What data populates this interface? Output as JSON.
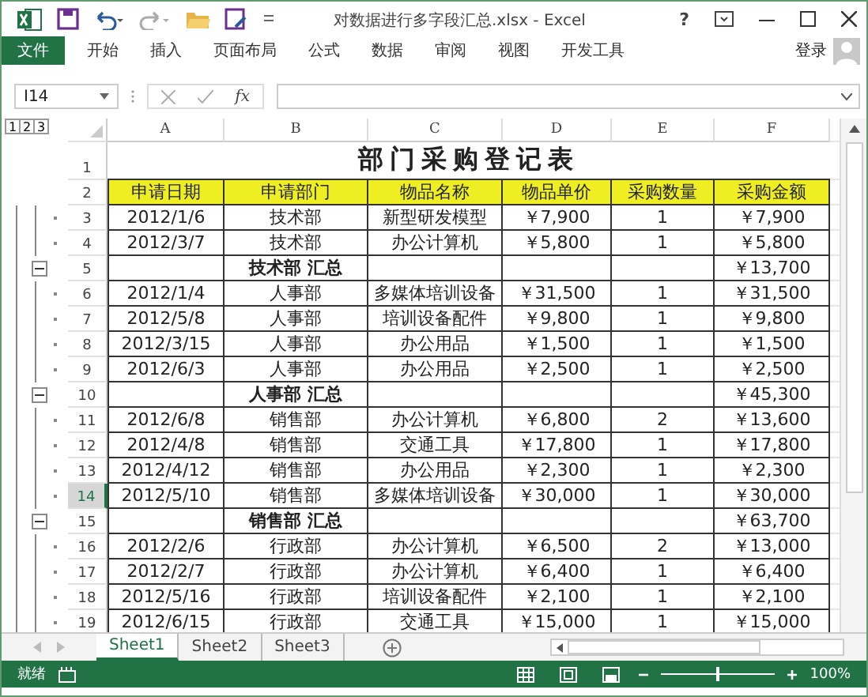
{
  "window": {
    "title": "对数据进行多字段汇总.xlsx - Excel",
    "help": "?"
  },
  "ribbon_tabs": [
    {
      "label": "文件",
      "kind": "file"
    },
    {
      "label": "开始",
      "kind": "tab"
    },
    {
      "label": "插入",
      "kind": "tab"
    },
    {
      "label": "页面布局",
      "kind": "tab"
    },
    {
      "label": "公式",
      "kind": "tab"
    },
    {
      "label": "数据",
      "kind": "tab"
    },
    {
      "label": "审阅",
      "kind": "tab"
    },
    {
      "label": "视图",
      "kind": "tab"
    },
    {
      "label": "开发工具",
      "kind": "tab"
    }
  ],
  "account": {
    "sign_in": "登录"
  },
  "formula_bar": {
    "name_box": "I14",
    "function_label": "fx"
  },
  "outline_levels": [
    "1",
    "2",
    "3"
  ],
  "columns": [
    "A",
    "B",
    "C",
    "D",
    "E",
    "F"
  ],
  "sheet": {
    "title_row": "1",
    "title": "部门采购登记表",
    "header_row": "2",
    "headers": [
      "申请日期",
      "申请部门",
      "物品名称",
      "物品单价",
      "采购数量",
      "采购金额"
    ],
    "rows": [
      {
        "number": "3",
        "kind": "detail",
        "selected": false,
        "cells": [
          "2012/1/6",
          "技术部",
          "新型研发模型",
          "￥7,900",
          "1",
          "￥7,900"
        ]
      },
      {
        "number": "4",
        "kind": "detail",
        "selected": false,
        "cells": [
          "2012/3/7",
          "技术部",
          "办公计算机",
          "￥5,800",
          "1",
          "￥5,800"
        ]
      },
      {
        "number": "5",
        "kind": "subtotal",
        "selected": false,
        "label": "技术部 汇总",
        "total": "￥13,700"
      },
      {
        "number": "6",
        "kind": "detail",
        "selected": false,
        "cells": [
          "2012/1/4",
          "人事部",
          "多媒体培训设备",
          "￥31,500",
          "1",
          "￥31,500"
        ]
      },
      {
        "number": "7",
        "kind": "detail",
        "selected": false,
        "cells": [
          "2012/5/8",
          "人事部",
          "培训设备配件",
          "￥9,800",
          "1",
          "￥9,800"
        ]
      },
      {
        "number": "8",
        "kind": "detail",
        "selected": false,
        "cells": [
          "2012/3/15",
          "人事部",
          "办公用品",
          "￥1,500",
          "1",
          "￥1,500"
        ]
      },
      {
        "number": "9",
        "kind": "detail",
        "selected": false,
        "cells": [
          "2012/6/3",
          "人事部",
          "办公用品",
          "￥2,500",
          "1",
          "￥2,500"
        ]
      },
      {
        "number": "10",
        "kind": "subtotal",
        "selected": false,
        "label": "人事部 汇总",
        "total": "￥45,300"
      },
      {
        "number": "11",
        "kind": "detail",
        "selected": false,
        "cells": [
          "2012/6/8",
          "销售部",
          "办公计算机",
          "￥6,800",
          "2",
          "￥13,600"
        ]
      },
      {
        "number": "12",
        "kind": "detail",
        "selected": false,
        "cells": [
          "2012/4/8",
          "销售部",
          "交通工具",
          "￥17,800",
          "1",
          "￥17,800"
        ]
      },
      {
        "number": "13",
        "kind": "detail",
        "selected": false,
        "cells": [
          "2012/4/12",
          "销售部",
          "办公用品",
          "￥2,300",
          "1",
          "￥2,300"
        ]
      },
      {
        "number": "14",
        "kind": "detail",
        "selected": true,
        "cells": [
          "2012/5/10",
          "销售部",
          "多媒体培训设备",
          "￥30,000",
          "1",
          "￥30,000"
        ]
      },
      {
        "number": "15",
        "kind": "subtotal",
        "selected": false,
        "label": "销售部 汇总",
        "total": "￥63,700"
      },
      {
        "number": "16",
        "kind": "detail",
        "selected": false,
        "cells": [
          "2012/2/6",
          "行政部",
          "办公计算机",
          "￥6,500",
          "2",
          "￥13,000"
        ]
      },
      {
        "number": "17",
        "kind": "detail",
        "selected": false,
        "cells": [
          "2012/2/7",
          "行政部",
          "办公计算机",
          "￥6,400",
          "1",
          "￥6,400"
        ]
      },
      {
        "number": "18",
        "kind": "detail",
        "selected": false,
        "cells": [
          "2012/5/16",
          "行政部",
          "培训设备配件",
          "￥2,100",
          "1",
          "￥2,100"
        ]
      },
      {
        "number": "19",
        "kind": "detail",
        "selected": false,
        "cells": [
          "2012/6/15",
          "行政部",
          "交通工具",
          "￥15,000",
          "1",
          "￥15,000"
        ]
      }
    ]
  },
  "sheet_tabs": [
    {
      "label": "Sheet1",
      "selected": true
    },
    {
      "label": "Sheet2",
      "selected": false
    },
    {
      "label": "Sheet3",
      "selected": false
    }
  ],
  "status_bar": {
    "status": "就绪",
    "zoom": "100%",
    "zoom_slider": {
      "level": 0.5
    }
  }
}
